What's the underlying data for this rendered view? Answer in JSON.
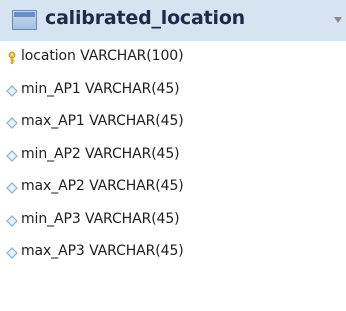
{
  "table": {
    "name": "calibrated_location",
    "columns": [
      {
        "name": "location",
        "type": "VARCHAR(100)",
        "icon": "primary-key-icon"
      },
      {
        "name": "min_AP1",
        "type": "VARCHAR(45)",
        "icon": "column-diamond-icon"
      },
      {
        "name": "max_AP1",
        "type": "VARCHAR(45)",
        "icon": "column-diamond-icon"
      },
      {
        "name": "min_AP2",
        "type": "VARCHAR(45)",
        "icon": "column-diamond-icon"
      },
      {
        "name": "max_AP2",
        "type": "VARCHAR(45)",
        "icon": "column-diamond-icon"
      },
      {
        "name": "min_AP3",
        "type": "VARCHAR(45)",
        "icon": "column-diamond-icon"
      },
      {
        "name": "max_AP3",
        "type": "VARCHAR(45)",
        "icon": "column-diamond-icon"
      }
    ]
  },
  "colors": {
    "header_bg": "#d6e3f1",
    "key_icon": "#e8c21a",
    "diamond_icon": "#7fb1d8"
  }
}
